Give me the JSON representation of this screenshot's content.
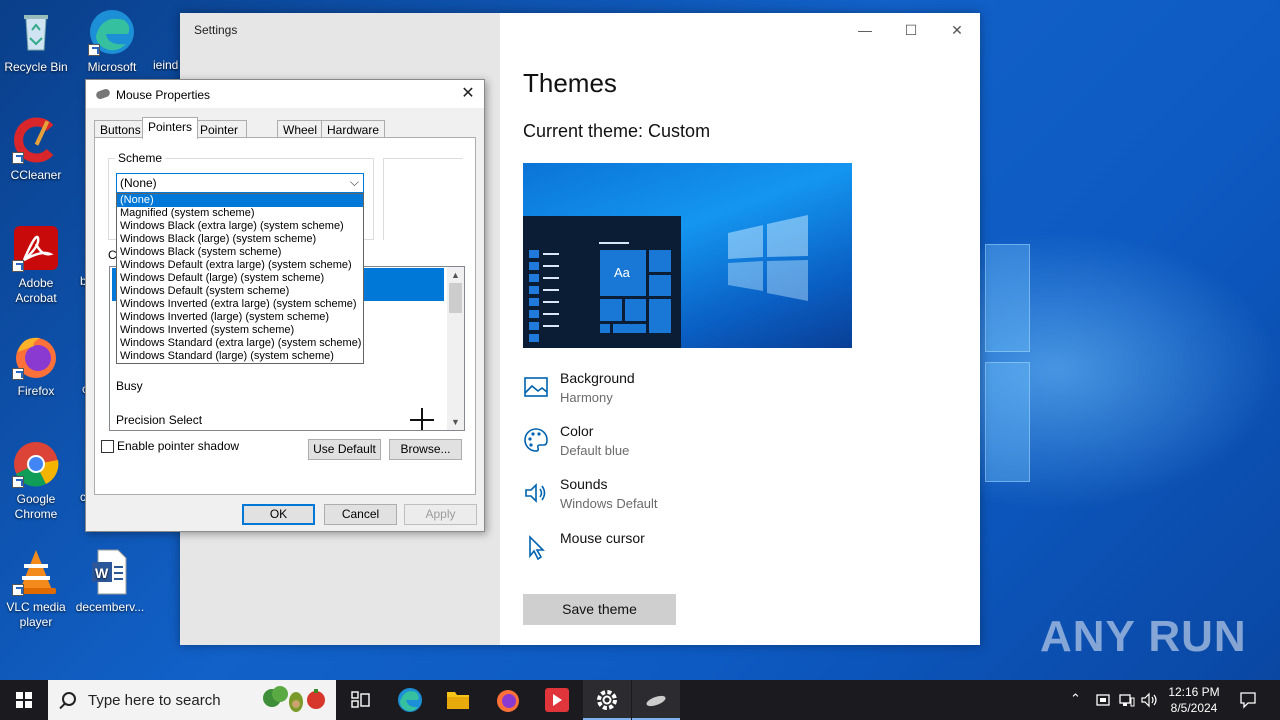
{
  "desktop": {
    "icons": [
      {
        "label": "Recycle Bin"
      },
      {
        "label": "Microsoft Edge"
      },
      {
        "label": "CCleaner"
      },
      {
        "label": "Adobe Acrobat"
      },
      {
        "label": "Firefox"
      },
      {
        "label": "Google Chrome"
      },
      {
        "label": "VLC media player"
      },
      {
        "label": "decemberv..."
      }
    ],
    "partial_labels": {
      "ieind": "ieind",
      "b": "b",
      "c1": "c",
      "c2": "c"
    },
    "watermark": "ANY RUN"
  },
  "settings": {
    "title": "Settings",
    "window_controls": {
      "minimize": "—",
      "maximize": "☐",
      "close": "✕"
    },
    "heading": "Themes",
    "current_theme_label": "Current theme: Custom",
    "preview": {
      "tile_text": "Aa"
    },
    "items": [
      {
        "title": "Background",
        "value": "Harmony",
        "icon": "picture-icon"
      },
      {
        "title": "Color",
        "value": "Default blue",
        "icon": "palette-icon"
      },
      {
        "title": "Sounds",
        "value": "Windows Default",
        "icon": "speaker-icon"
      },
      {
        "title": "Mouse cursor",
        "value": "",
        "icon": "cursor-icon"
      }
    ],
    "save_button": "Save theme"
  },
  "mouse_properties": {
    "title": "Mouse Properties",
    "close": "✕",
    "tabs": [
      "Buttons",
      "Pointers",
      "Pointer Options",
      "Wheel",
      "Hardware"
    ],
    "active_tab": "Pointers",
    "scheme_label": "Scheme",
    "scheme_selected": "(None)",
    "scheme_options": [
      "(None)",
      "Magnified (system scheme)",
      "Windows Black (extra large) (system scheme)",
      "Windows Black (large) (system scheme)",
      "Windows Black (system scheme)",
      "Windows Default (extra large) (system scheme)",
      "Windows Default (large) (system scheme)",
      "Windows Default (system scheme)",
      "Windows Inverted (extra large) (system scheme)",
      "Windows Inverted (large) (system scheme)",
      "Windows Inverted (system scheme)",
      "Windows Standard (extra large) (system scheme)",
      "Windows Standard (large) (system scheme)"
    ],
    "customize_label_partial": "C",
    "pointer_rows": [
      "Busy",
      "Precision Select"
    ],
    "enable_shadow": "Enable pointer shadow",
    "use_default": "Use Default",
    "browse": "Browse...",
    "ok": "OK",
    "cancel": "Cancel",
    "apply": "Apply"
  },
  "taskbar": {
    "search_placeholder": "Type here to search",
    "time": "12:16 PM",
    "date": "8/5/2024",
    "pinned": [
      "task-view-icon",
      "edge-icon",
      "file-explorer-icon",
      "firefox-icon",
      "anyrun-icon",
      "settings-icon",
      "mouse-icon"
    ]
  }
}
